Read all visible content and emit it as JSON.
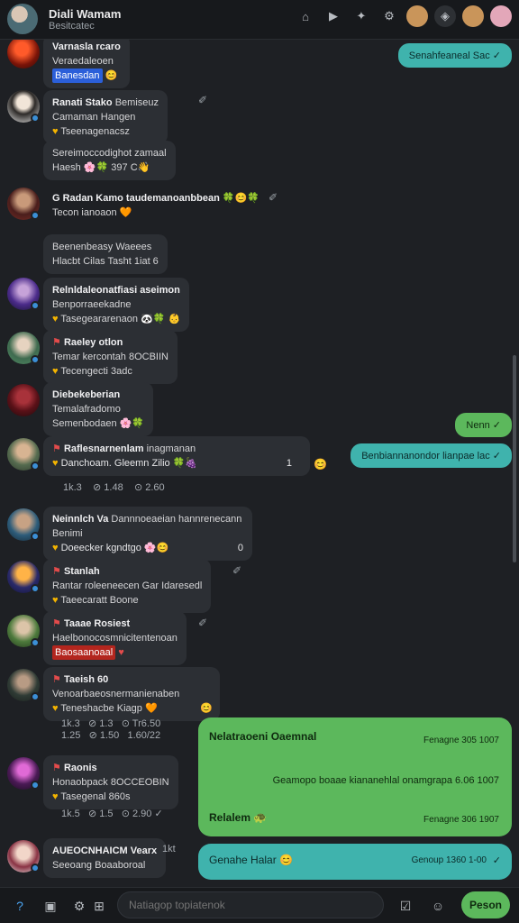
{
  "header": {
    "name": "Diali Wamam",
    "subtitle": "Besitcatec"
  },
  "messages": [
    {
      "name": "Varnasla rcaro",
      "sub": "Veraedaleoen",
      "badge": "Banesdan",
      "emoji": "😊"
    },
    {
      "name": "Ranati Stako",
      "extra": "Bemiseuz",
      "line2": "Camaman Hangen",
      "line3": "Tseenagenacsz"
    },
    {
      "line1": "Sereimoccodighot zamaal",
      "line2": "Haesh 🌸🍀 397 C👋"
    },
    {
      "name": "G Radan Kamo",
      "line1": "taudemanoanbbean 🍀😊🍀",
      "line2": "Tecon ianoaon 🧡"
    },
    {
      "line1": "Beenenbeasy Waeees",
      "line2": "Hlacbt Cilas Tasht 1iat 6"
    },
    {
      "name": "Relnldaleonatfiasi aseimon",
      "line2": "Benporraeekadne",
      "line3": "Tasegeararenaon 🐼🍀 👶"
    },
    {
      "name": "Raeley otlon",
      "line2": "Temar kercontah 8OCBIIN",
      "line3": "Tecengecti 3adc"
    },
    {
      "name": "Diebekeberian",
      "line2": "Temalafradomo",
      "line3": "Semenbodaen 🌸🍀"
    },
    {
      "name": "Raflesnarnenlam",
      "extra": "inagmanan",
      "line2": "Danchoam. Gleemn Zilio 🍀🍇",
      "meta": [
        "1k.3",
        "1.48",
        "2.60"
      ]
    },
    {
      "name": "Neinnlch Va",
      "extra": "Dannnoeaeian hannrenecann",
      "line2": "Benimi",
      "line3": "Doeecker kgndtgo 🌸😊"
    },
    {
      "name": "Stanlah",
      "line2": "Rantar roleeneecen Gar Idaresedl",
      "line3": "Taeecaratt Boone"
    },
    {
      "name": "Taaae Rosiest",
      "line2": "Haelbonocosmnicitentenoan",
      "badge": "Baosaanoaal"
    },
    {
      "name": "Taeish 60",
      "line2": "Venoarbaeosnermanienaben",
      "line3": "Teneshacbe Kiagp 🧡",
      "meta": [
        "1k.3",
        "1.3",
        "Tr6.50",
        "1.25",
        "1.50",
        "1.60/22"
      ]
    },
    {
      "name": "Raonis",
      "line2": "Honaobpack 8OCCEOBIN",
      "line3": "Tasegenal 860s",
      "meta": [
        "1k.5",
        "1.5",
        "2.90"
      ]
    },
    {
      "name": "AUEOCNHAICM Vearx",
      "extra": "1kt",
      "line2": "Seeoang Boaaboroal"
    }
  ],
  "outgoing": [
    {
      "text": "Senahfeaneal Sac",
      "tick": "✓"
    },
    {
      "text": "Nenn",
      "tick": "✓"
    },
    {
      "text": "Benbiannanondor lianpae lac",
      "tick": "✓"
    },
    {
      "title": "Nelatraoeni Oaemnal",
      "time1": "Fenagne 305 1007",
      "line2": "Geamopo boaae kiananehlal onamgrapa 6.06 1007",
      "line3": "Relalem 🐢",
      "time3": "Fenagne 306 1907"
    },
    {
      "text": "Genahe Halar 😊",
      "time": "Genoup 1360 1-00",
      "tick": "✓"
    }
  ],
  "composer": {
    "placeholder": "Natiagop topiatenok",
    "send_label": "Peson"
  },
  "colors": {
    "background": "#1e2024",
    "incoming_bubble": "#2c2f34",
    "outgoing_teal": "#3fb3ad",
    "outgoing_green": "#5cb85c"
  }
}
